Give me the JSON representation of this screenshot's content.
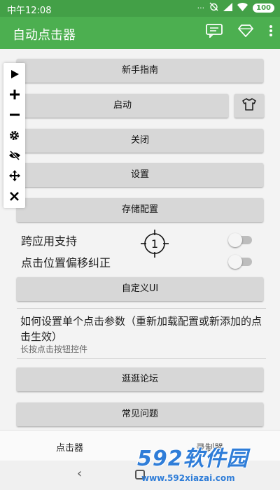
{
  "status_bar": {
    "time": "中午12:08",
    "battery": "100"
  },
  "app_bar": {
    "title": "自动点击器"
  },
  "buttons": {
    "guide": "新手指南",
    "start": "启动",
    "close": "关闭",
    "settings": "设置",
    "save_config": "存储配置",
    "custom_ui": "自定义UI",
    "forum": "逛逛论坛",
    "faq": "常见问题"
  },
  "switches": {
    "cross_app": {
      "label": "跨应用支持",
      "on": false
    },
    "offset_fix": {
      "label": "点击位置偏移纠正",
      "on": false
    }
  },
  "target": {
    "label": "1"
  },
  "info": {
    "title": "如何设置单个点击参数（重新加载配置或新添加的点击生效）",
    "subtitle": "长按点击按钮控件"
  },
  "tabs": [
    "点击器",
    "录制器"
  ],
  "watermark": {
    "brand": "592软件园",
    "url": "www.592xiazai.com"
  },
  "colors": {
    "app_bar": "#4caf50",
    "status_bar": "#43a047",
    "button": "#d7d7d7"
  }
}
